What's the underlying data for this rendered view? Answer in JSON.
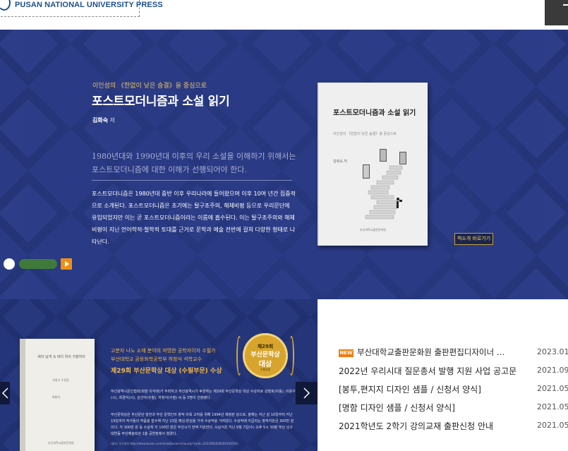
{
  "header": {
    "logo_text": "PUSAN NATIONAL UNIVERSITY PRESS",
    "logo_icon": "university-emblem-icon",
    "menu_icon": "menu-icon"
  },
  "hero": {
    "subtitle": "이인성의 《한없이 낮은 숨결》을 중심으로",
    "title": "포스트모더니즘과 소설 읽기",
    "author_name": "김화숙",
    "author_role": " 저",
    "lead": "1980년대와 1990년대 이후의 우리 소설을 이해하기 위해서는 포스트모더니즘에 대한 이해가 선행되어야 한다.",
    "body": "포스트모더니즘은 1980년대 중반 이후 우리나라에 들어왔으며 이후 10여 년간 집중적으로 소개된다. 포스트모더니즘은 초기에는 탈구조주의, 해체비평 등으로 우리문단에 유입되었지만 이는 곧 포스트모더니즘이라는 이름에 흡수된다. 이는 탈구조주의와 해체비평이 지닌 언어학적·철학적 토대를 근거로 문학과 예술 전반에 걸쳐 다양한 형태로 나타난다.",
    "book": {
      "title": "포스트모더니즘과 소설 읽기",
      "subtitle": "이인성의 《한없이 낮은 숨결》을 중심으로",
      "author": "김화숙 저",
      "publisher": "부산대학교출판문화원"
    },
    "intro_button": "책소개 바로가기",
    "controls": {
      "pause_icon": "pagination-dot-icon",
      "progress_icon": "progress-bar-icon",
      "play_icon": "play-icon"
    },
    "colors": {
      "background": "#2a3a84",
      "accent": "#e8c66a",
      "play": "#ef8f12"
    }
  },
  "banner": {
    "line1": "고분자 나노 소재 분야의 저명한 공학자이자 수필가",
    "line2": "부산대학교 공응화학공학부 하창식 석학교수",
    "award_line": "제29회 부산문학상 대상 (수필부문) 수상",
    "p1": "부산광역시문인협회(회장 이석래)가 주최하고 부산광역시가 후원하는 제29회 부산문학상 대상 수상자로 김명호(아동), 이용우(시), 최경식(시), 김선아(수필), 하창식(수필) 씨 등 5명이 선정됐다.",
    "p2": "부산문학상은 부산문단 발전과 부산 문학인의 창작 의욕 고취를 위해 1994년 제정된 상으로, 올해는 지난 달 10일부터 지난 19일까지 작가들의 작품을 접수해 지난 23일 예심·본심을 거쳐 수상작을 가려냈다. 수상작에 지급되는 창작지원금 300만 원이다. 각 300만 원 등 수상자 각 100만 원은 부산시가 전액 지원한다. 시상식은 지난 9월 7일(수) 오후 5시 30분 부산 남구 대연동 부산예술회관 1층 공연장에서 열렸다.",
    "source": "(출처: 부산일보 http://www.busan.com/view/busan/view.php?code=2022082608181004503)",
    "book": {
      "title": "새의 날개 속 바다 위의 가장자리",
      "tag": "하창식 수필집",
      "author": "하창식",
      "publisher": "부산대학교출판문화원"
    },
    "medal": {
      "round": "제29회",
      "prize": "부산문학상",
      "grand": "대상",
      "winner": "수필부문"
    },
    "prev_icon": "chevron-left-icon",
    "next_icon": "chevron-right-icon"
  },
  "notices": {
    "new_badge": "NEW",
    "items": [
      {
        "title": "부산대학교출판문화원 출판편집디자이너 …",
        "date": "2023.01"
      },
      {
        "title": "2022년 우리시대 질문총서 발행 지원 사업 공고문",
        "date": "2021.09"
      },
      {
        "title": "[봉투,편지지 디자인 샘플 / 신청서 양식]",
        "date": "2021.05"
      },
      {
        "title": "[명함 디자인 샘플 / 신청서 양식]",
        "date": "2021.05"
      },
      {
        "title": "2021학년도 2학기 강의교재 출판신청 안내",
        "date": "2021.05"
      }
    ]
  }
}
